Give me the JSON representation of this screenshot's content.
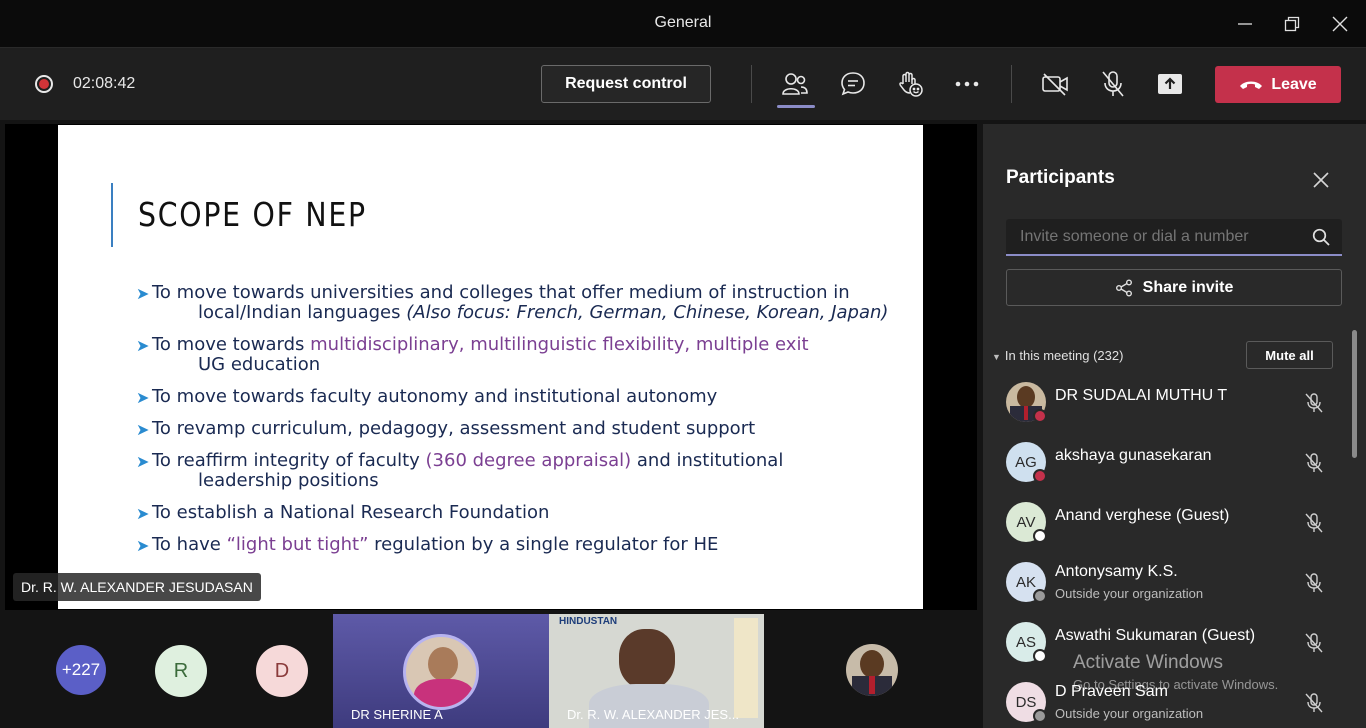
{
  "window": {
    "title": "General"
  },
  "toolbar": {
    "timer": "02:08:42",
    "request_control": "Request control",
    "leave_label": "Leave"
  },
  "slide": {
    "title": "SCOPE OF NEP",
    "b1a": "To move towards universities and colleges that offer medium of instruction in",
    "b1b": "local/Indian languages",
    "b1c": "(Also focus: French, German, Chinese, Korean, Japan)",
    "b2a": "To move towards",
    "b2b": "multidisciplinary, multilinguistic flexibility, multiple exit",
    "b2c": "UG education",
    "b3": "To move towards faculty autonomy and institutional autonomy",
    "b4": "To revamp curriculum, pedagogy, assessment and student support",
    "b5a": "To reaffirm integrity of faculty",
    "b5b": "(360 degree appraisal)",
    "b5c": "and institutional",
    "b5d": "leadership positions",
    "b6": "To establish a National Research Foundation",
    "b7a": "To have",
    "b7b": "“light but tight”",
    "b7c": "regulation by a single regulator for HE"
  },
  "speaker_label": "Dr. R. W. ALEXANDER JESUDASAN",
  "strip": {
    "overflow_count": "+227",
    "avatar_r": "R",
    "avatar_d": "D",
    "tile1_name": "DR SHERINE A",
    "tile2_name": "Dr. R. W. ALEXANDER JES...",
    "tile2_logo": "HINDUSTAN"
  },
  "panel": {
    "title": "Participants",
    "invite_placeholder": "Invite someone or dial a number",
    "share_invite": "Share invite",
    "in_meeting": "In this meeting (232)",
    "mute_all": "Mute all",
    "participants": [
      {
        "initials": "",
        "name": "DR SUDALAI MUTHU T",
        "sub": ""
      },
      {
        "initials": "AG",
        "name": "akshaya gunasekaran",
        "sub": ""
      },
      {
        "initials": "AV",
        "name": "Anand verghese (Guest)",
        "sub": ""
      },
      {
        "initials": "AK",
        "name": "Antonysamy K.S.",
        "sub": "Outside your organization"
      },
      {
        "initials": "AS",
        "name": "Aswathi Sukumaran (Guest)",
        "sub": ""
      },
      {
        "initials": "DS",
        "name": "D Praveen Sam",
        "sub": "Outside your organization"
      }
    ]
  },
  "watermark": {
    "line1": "Activate Windows",
    "line2": "Go to Settings to activate Windows."
  },
  "colors": {
    "leave": "#c4314b",
    "accent": "#8b8cc7",
    "busy": "#c4314b",
    "slide_purple": "#7b3f92"
  }
}
